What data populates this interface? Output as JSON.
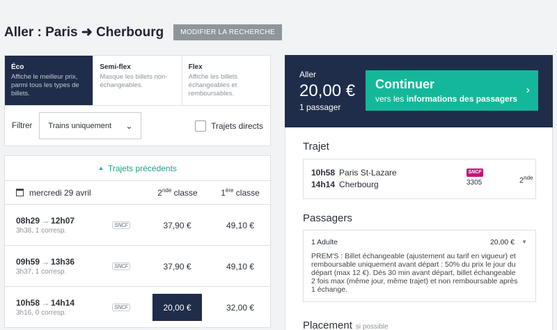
{
  "header": {
    "title": "Aller : Paris ➜ Cherbourg",
    "modify_label": "MODIFIER LA RECHERCHE"
  },
  "tabs": [
    {
      "name": "Éco",
      "desc": "Affiche le meilleur prix, parmi tous les types de billets."
    },
    {
      "name": "Semi-flex",
      "desc": "Masque les billets non-échangeables."
    },
    {
      "name": "Flex",
      "desc": "Affiche les billets échangeables et remboursables."
    }
  ],
  "filter": {
    "label": "Filtrer",
    "selected": "Trains uniquement",
    "direct_label": "Trajets directs"
  },
  "previous_label": "Trajets précédents",
  "columns": {
    "date": "mercredi 29 avril",
    "c2_base": "2",
    "c2_sup": "nde",
    "c2_word": " classe",
    "c1_base": "1",
    "c1_sup": "ère",
    "c1_word": " classe"
  },
  "trains": [
    {
      "dep": "08h29",
      "arr": "12h07",
      "dur": "3h38, 1 corresp.",
      "logo": "SNCF",
      "p2": "37,90 €",
      "p1": "49,10 €"
    },
    {
      "dep": "09h59",
      "arr": "13h36",
      "dur": "3h37, 1 corresp.",
      "logo": "SNCF",
      "p2": "37,90 €",
      "p1": "49,10 €"
    },
    {
      "dep": "10h58",
      "arr": "14h14",
      "dur": "3h16, 0 corresp.",
      "logo": "SNCF",
      "p2": "20,00 €",
      "p1": "32,00 €"
    }
  ],
  "summary": {
    "direction": "Aller",
    "price": "20,00 €",
    "passengers": "1 passager"
  },
  "continue": {
    "title": "Continuer",
    "sub_prefix": "vers les ",
    "sub_bold": "informations des passagers"
  },
  "trajet": {
    "heading": "Trajet",
    "dep_time": "10h58",
    "dep_station": "Paris St-Lazare",
    "arr_time": "14h14",
    "arr_station": "Cherbourg",
    "logo": "SNCF",
    "train_number": "3305",
    "class_base": "2",
    "class_sup": "nde"
  },
  "passagers": {
    "heading": "Passagers",
    "who": "1 Adulte",
    "amount": "20,00 €",
    "conditions": "PREM'S : Billet échangeable (ajustement au tarif en vigueur) et remboursable uniquement avant départ : 50% du prix le jour du départ (max 12 €). Dès 30 min avant départ, billet échangeable 2 fois max (même jour, même trajet) et non remboursable après 1 échange."
  },
  "placement": {
    "heading": "Placement",
    "hint": "si possible"
  },
  "colors": {
    "navy": "#1f2d4a",
    "teal": "#15b79a",
    "sncf": "#c7147c"
  }
}
